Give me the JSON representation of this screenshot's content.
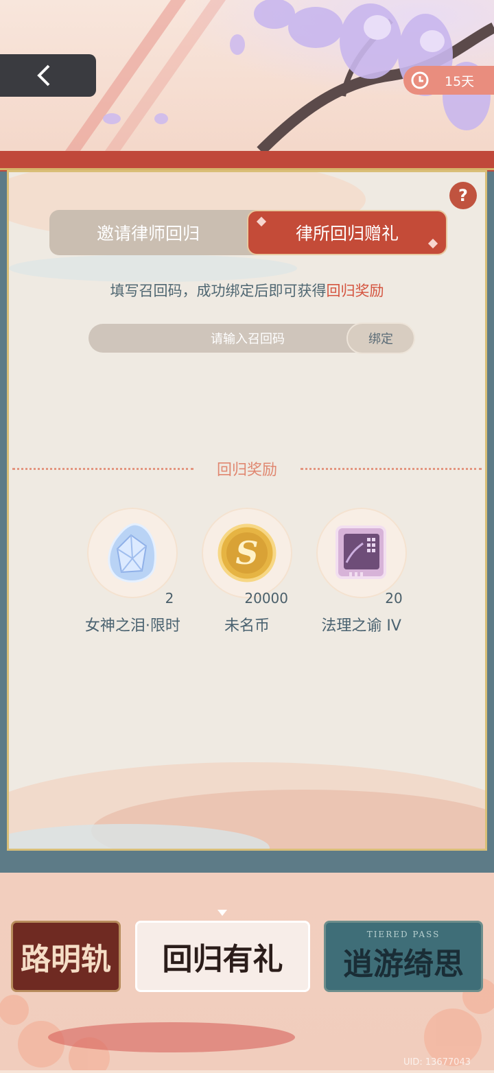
{
  "timer": {
    "label": "15天"
  },
  "tabs": [
    {
      "label": "邀请律师回归",
      "active": false
    },
    {
      "label": "律所回归赠礼",
      "active": true
    }
  ],
  "description": {
    "text": "填写召回码，成功绑定后即可获得",
    "highlight": "回归奖励"
  },
  "bind": {
    "placeholder": "请输入召回码",
    "button": "绑定"
  },
  "section": {
    "title": "回归奖励"
  },
  "rewards": [
    {
      "name": "女神之泪·限时",
      "count": "2",
      "icon": "teardrop-crystal-icon"
    },
    {
      "name": "未名币",
      "count": "20000",
      "icon": "gold-coin-icon"
    },
    {
      "name": "法理之谕 IV",
      "count": "20",
      "icon": "card-chip-icon"
    }
  ],
  "banners": [
    {
      "label": "路明轨"
    },
    {
      "label": "回归有礼"
    },
    {
      "label": "逍游绮思",
      "sub": "TIERED PASS"
    }
  ],
  "footer": {
    "uid": "UID: 13677043"
  },
  "colors": {
    "accent": "#c44b38",
    "tab_bg": "#cabeb1",
    "panel": "#efeae2",
    "text": "#4f6772"
  }
}
